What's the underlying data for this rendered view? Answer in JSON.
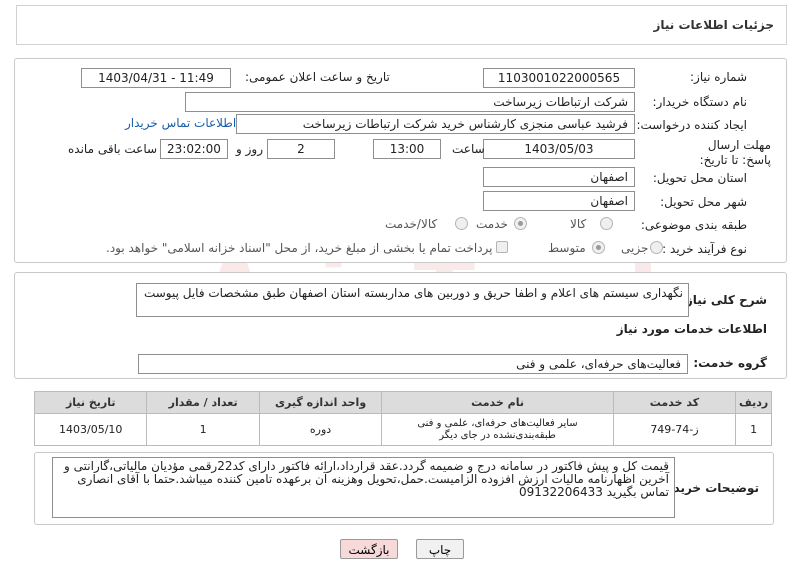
{
  "header": {
    "title": "جزئیات اطلاعات نیاز"
  },
  "fields": {
    "need_number_label": "شماره نیاز:",
    "need_number": "1103001022000565",
    "announce_label": "تاریخ و ساعت اعلان عمومی:",
    "announce_value": "1403/04/31 - 11:49",
    "buyer_org_label": "نام دستگاه خریدار:",
    "buyer_org": "شرکت ارتباطات زیرساخت",
    "creator_label": "ایجاد کننده درخواست:",
    "creator": "فرشید عباسی منجزی کارشناس خرید شرکت ارتباطات زیرساخت",
    "contact_link": "اطلاعات تماس خریدار",
    "deadline_label": "مهلت ارسال پاسخ: تا تاریخ:",
    "deadline_date": "1403/05/03",
    "time_label": "ساعت",
    "deadline_time": "13:00",
    "days_value": "2",
    "days_label": "روز و",
    "remaining_time": "23:02:00",
    "remaining_label": "ساعت باقی مانده",
    "province_label": "استان محل تحویل:",
    "province": "اصفهان",
    "city_label": "شهر محل تحویل:",
    "city": "اصفهان",
    "category_label": "طبقه بندی موضوعی:",
    "category_options": [
      "کالا",
      "خدمت",
      "کالا/خدمت"
    ],
    "process_label": "نوع فرآیند خرید :",
    "process_options": [
      "جزیی",
      "متوسط"
    ],
    "payment_note": "پرداخت تمام یا بخشی از مبلغ خرید، از محل \"اسناد خزانه اسلامی\" خواهد بود."
  },
  "description": {
    "label": "شرح کلی نیاز:",
    "text": "نگهداری سیستم های اعلام و اطفا حریق و دوربین های مداربسته استان اصفهان طبق مشخصات فایل پیوست"
  },
  "services": {
    "section_title": "اطلاعات خدمات مورد نیاز",
    "group_label": "گروه خدمت:",
    "group_value": "فعالیت‌های حرفه‌ای، علمی و فنی",
    "columns": [
      "ردیف",
      "کد خدمت",
      "نام خدمت",
      "واحد اندازه گیری",
      "تعداد / مقدار",
      "تاریخ نیاز"
    ],
    "rows": [
      [
        "1",
        "ز-74-749",
        "سایر فعالیت‌های حرفه‌ای، علمی و فنی طبقه‌بندی‌نشده در جای دیگر",
        "دوره",
        "1",
        "1403/05/10"
      ]
    ]
  },
  "buyer_notes": {
    "label": "توضیحات خریدار:",
    "text": "قیمت کل و پیش فاکتور در سامانه درج و ضمیمه گردد.عقد قرارداد،ارائه فاکتور دارای کد22رقمی مؤدیان مالیاتی،گارانتی و آخرین اظهارنامه مالیات ارزش افزوده الزامیست.حمل،تحویل وهزینه آن برعهده تامین کننده میباشد.حتما با آقای انصاری تماس بگیرید 09132206433"
  },
  "buttons": {
    "print": "چاپ",
    "back": "بازگشت"
  },
  "watermark": "AriaTender.neT",
  "colors": {
    "link": "#1a5ea8",
    "back_button_bg": "#f7d9d9",
    "header_bg": "#ffffff"
  }
}
